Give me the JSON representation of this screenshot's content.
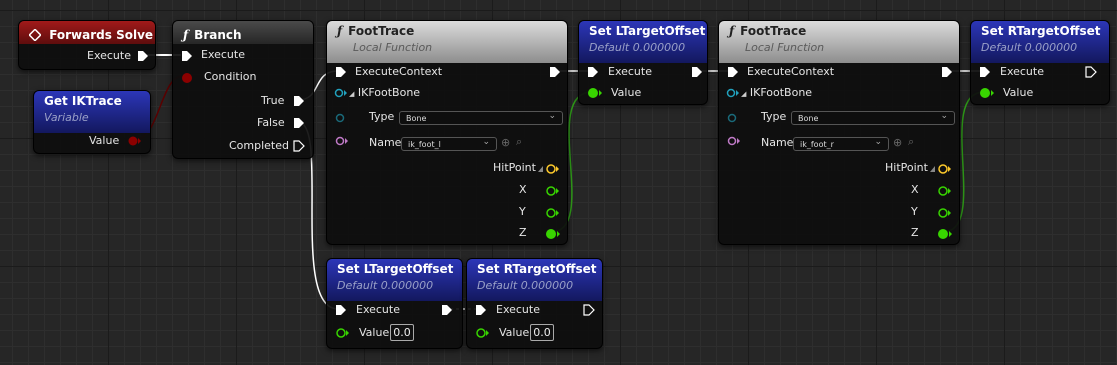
{
  "nodes": {
    "forwards_solve": {
      "title": "Forwards Solve",
      "execute": "Execute"
    },
    "get_iktrace": {
      "title": "Get IKTrace",
      "subtitle": "Variable",
      "value": "Value"
    },
    "branch": {
      "title": "Branch",
      "execute": "Execute",
      "condition": "Condition",
      "true": "True",
      "false": "False",
      "completed": "Completed"
    },
    "foottrace_l": {
      "title": "FootTrace",
      "subtitle": "Local Function",
      "exec_ctx": "ExecuteContext",
      "ikfootbone": "IKFootBone",
      "type_label": "Type",
      "type_value": "Bone",
      "name_label": "Name",
      "name_value": "ik_foot_l",
      "hitpoint": "HitPoint",
      "x": "X",
      "y": "Y",
      "z": "Z"
    },
    "set_ltarget_1": {
      "title": "Set LTargetOffset",
      "subtitle": "Default 0.000000",
      "execute": "Execute",
      "value": "Value"
    },
    "foottrace_r": {
      "title": "FootTrace",
      "subtitle": "Local Function",
      "exec_ctx": "ExecuteContext",
      "ikfootbone": "IKFootBone",
      "type_label": "Type",
      "type_value": "Bone",
      "name_label": "Name",
      "name_value": "ik_foot_r",
      "hitpoint": "HitPoint",
      "x": "X",
      "y": "Y",
      "z": "Z"
    },
    "set_rtarget_1": {
      "title": "Set RTargetOffset",
      "subtitle": "Default 0.000000",
      "execute": "Execute",
      "value": "Value"
    },
    "set_ltarget_2": {
      "title": "Set LTargetOffset",
      "subtitle": "Default 0.000000",
      "execute": "Execute",
      "value": "Value",
      "value_input": "0.0"
    },
    "set_rtarget_2": {
      "title": "Set RTargetOffset",
      "subtitle": "Default 0.000000",
      "execute": "Execute",
      "value": "Value",
      "value_input": "0.0"
    }
  },
  "icons": {
    "function": "function-icon",
    "event": "event-diamond-icon",
    "exec_pin": "exec-pin-icon",
    "data_pin": "data-pin-icon",
    "dropdown": "chevron-down-icon",
    "search": "search-icon",
    "reset": "reset-icon"
  },
  "colors": {
    "exec": "#ffffff",
    "bool": "#8c0000",
    "float": "#38d500",
    "struct": "#21a1bd",
    "name": "#c07ac7",
    "vector": "#fdc92b",
    "event_header": "#a11a1a",
    "variable_header": "#2c36b8",
    "function_header": "#c8c8c8"
  }
}
